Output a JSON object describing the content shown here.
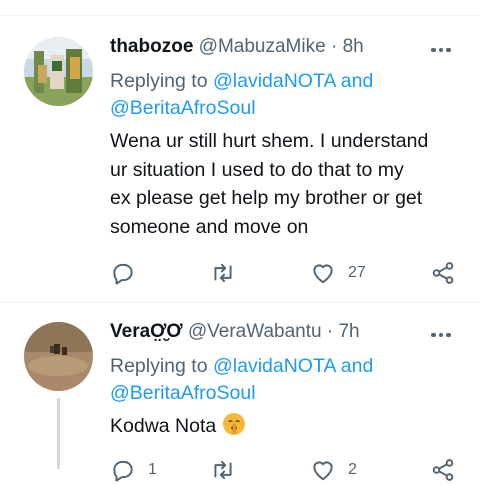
{
  "tweets": [
    {
      "name": "thabozoe",
      "handle": "@MabuzaMike",
      "dot": "·",
      "time": "8h",
      "replying_prefix": "Replying to",
      "mention1": "@lavidaNOTA",
      "and_word": "and",
      "mention2": "@BeritaAfroSoul",
      "text_lines": [
        "Wena ur still hurt shem. I understand",
        "ur situation I used to do that to my",
        "ex please get help my brother or get",
        "someone and move on"
      ],
      "reply_count": "",
      "retweet_count": "",
      "like_count": "27",
      "avatar_icon": "profile-photo",
      "more_icon": "ellipsis-icon"
    },
    {
      "name": "Vera",
      "name_suffix": "Ơ̤̮Ơ",
      "handle": "@VeraWabantu",
      "dot": "·",
      "time": "7h",
      "replying_prefix": "Replying to",
      "mention1": "@lavidaNOTA",
      "and_word": "and",
      "mention2": "@BeritaAfroSoul",
      "text": "Kodwa Nota",
      "emoji": "shushing-face-emoji",
      "reply_count": "1",
      "like_count": "2"
    }
  ],
  "colors": {
    "link": "#1d9bf0",
    "secondary": "#536471",
    "primary": "#0f1419",
    "divider": "#eff3f4",
    "thread_line": "#cfd9de"
  }
}
